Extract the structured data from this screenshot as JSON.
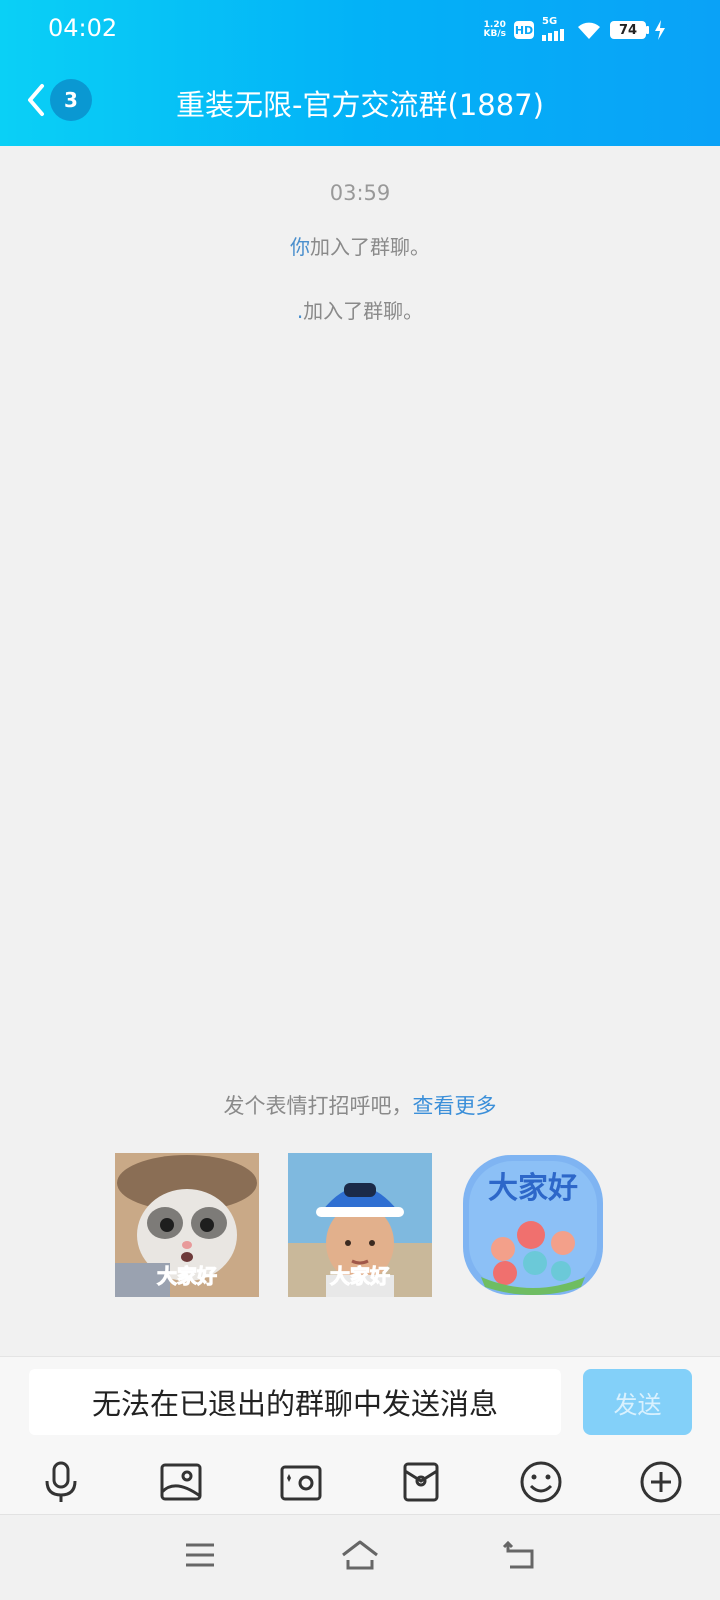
{
  "status_bar": {
    "time": "04:02",
    "net_speed_value": "1.20",
    "net_speed_unit": "KB/s",
    "hd": "HD",
    "network": "5G",
    "battery": "74"
  },
  "nav": {
    "unread_count": "3",
    "title": "重装无限-官方交流群(1887)"
  },
  "chat": {
    "timestamp": "03:59",
    "messages": [
      {
        "actor": "你",
        "text": "加入了群聊。"
      },
      {
        "actor": ".",
        "text": "加入了群聊。"
      }
    ]
  },
  "greeting": {
    "prompt": "发个表情打招呼吧，",
    "link": "查看更多"
  },
  "stickers": [
    {
      "label": "大家好",
      "icon": "cat-sticker"
    },
    {
      "label": "大家好",
      "icon": "boy-sticker"
    },
    {
      "label": "大家好",
      "icon": "flowers-sticker"
    }
  ],
  "input": {
    "disabled_text": "无法在已退出的群聊中发送消息",
    "send_label": "发送"
  },
  "toolbar": [
    "microphone-icon",
    "image-icon",
    "camera-icon",
    "red-packet-icon",
    "emoji-icon",
    "plus-icon"
  ],
  "colors": {
    "header_start": "#0ad0f6",
    "header_end": "#0aa2f7",
    "link": "#3b8fd9",
    "send_disabled": "#83d0f9"
  }
}
